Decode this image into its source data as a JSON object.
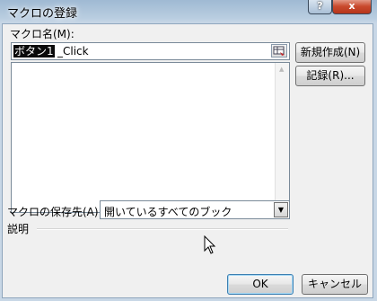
{
  "window": {
    "title": "マクロの登録",
    "help_label": "?",
    "close_label": "x"
  },
  "macro_name": {
    "label": "マクロ名(M):",
    "value_selected": "ボタン1",
    "value_rest": "_Click"
  },
  "buttons": {
    "new": "新規作成(N)",
    "record": "記録(R)...",
    "ok": "OK",
    "cancel": "キャンセル"
  },
  "store": {
    "label": "マクロの保存先(A):",
    "value": "開いているすべてのブック"
  },
  "description": {
    "label": "説明"
  }
}
